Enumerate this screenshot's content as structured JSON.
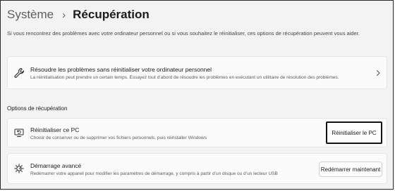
{
  "breadcrumb": {
    "parent": "Système",
    "separator": "›",
    "current": "Récupération"
  },
  "intro_text": "Si vous rencontrez des problèmes avec votre ordinateur personnel ou si vous souhaitez le réinitialiser, ces options de récupération peuvent vous aider.",
  "troubleshoot": {
    "title": "Résoudre les problèmes sans réinitialiser votre ordinateur personnel",
    "description": "La réinitialisation peut prendre un certain temps. Essayez tout d’abord de résoudre les problèmes en exécutant un utilitaire de résolution des problèmes.",
    "icon": "wrench-icon"
  },
  "section_title": "Options de récupération",
  "reset_pc": {
    "title": "Réinitialiser ce PC",
    "description": "Choisir de conserver ou de supprimer vos fichiers personnels, puis réinstaller Windows",
    "button_label": "Réinitialiser le PC",
    "icon": "reset-pc-icon"
  },
  "advanced_startup": {
    "title": "Démarrage avancé",
    "description": "Redémarrer votre appareil pour modifier les paramètres de démarrage, y compris à partir d’un disque ou d’un lecteur USB",
    "button_label": "Redémarrer maintenant",
    "icon": "advanced-startup-icon"
  },
  "colors": {
    "background": "#f3f3f3",
    "card": "#fbfbfb",
    "highlight_border": "#111111"
  }
}
